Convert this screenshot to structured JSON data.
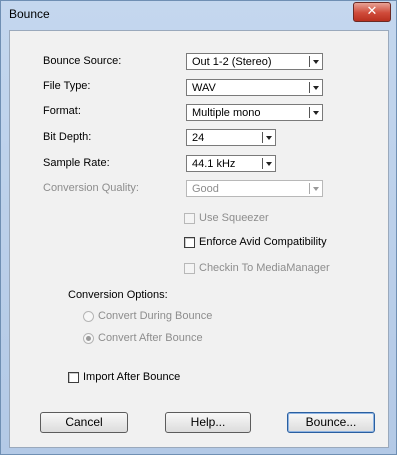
{
  "window": {
    "title": "Bounce"
  },
  "fields": {
    "bounce_source": {
      "label": "Bounce Source:",
      "value": "Out 1-2 (Stereo)"
    },
    "file_type": {
      "label": "File Type:",
      "value": "WAV"
    },
    "format": {
      "label": "Format:",
      "value": "Multiple mono"
    },
    "bit_depth": {
      "label": "Bit Depth:",
      "value": "24"
    },
    "sample_rate": {
      "label": "Sample Rate:",
      "value": "44.1 kHz"
    },
    "conversion_quality": {
      "label": "Conversion Quality:",
      "value": "Good",
      "enabled": false
    }
  },
  "checkboxes": {
    "use_squeezer": {
      "label": "Use Squeezer",
      "checked": false,
      "enabled": false
    },
    "enforce_avid": {
      "label": "Enforce Avid Compatibility",
      "checked": false,
      "enabled": true
    },
    "checkin_media": {
      "label": "Checkin To MediaManager",
      "checked": false,
      "enabled": false
    },
    "import_after": {
      "label": "Import After Bounce",
      "checked": false,
      "enabled": true
    }
  },
  "conversion_options": {
    "label": "Conversion Options:",
    "during": {
      "label": "Convert During Bounce",
      "selected": false,
      "enabled": false
    },
    "after": {
      "label": "Convert After Bounce",
      "selected": true,
      "enabled": false
    }
  },
  "buttons": {
    "cancel": "Cancel",
    "help": "Help...",
    "bounce": "Bounce..."
  },
  "icons": {
    "close": "close-icon",
    "dropdown": "chevron-down-icon"
  }
}
